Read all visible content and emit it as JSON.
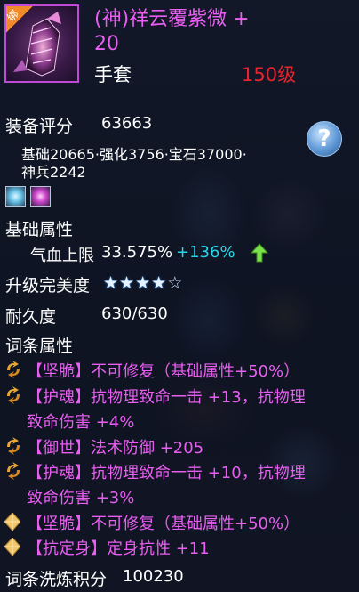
{
  "item": {
    "bound_tag": "绑",
    "title_line1": "(神)祥云覆紫微 +",
    "title_line2": "20",
    "type": "手套",
    "level": "150级"
  },
  "score": {
    "label": "装备评分",
    "value": "63663"
  },
  "breakdown": {
    "line1": "基础20665·强化3756·宝石37000·",
    "line2": "神兵2242"
  },
  "help": {
    "icon": "question-icon",
    "symbol": "?"
  },
  "gems": [
    "diamond-gem-icon",
    "ruby-gem-icon"
  ],
  "base_attr": {
    "header": "基础属性",
    "name": "气血上限",
    "value": "33.575%",
    "bonus": "+136%",
    "trend_icon": "arrow-up-icon"
  },
  "upgrade": {
    "label": "升级完美度",
    "stars_filled": 4,
    "stars_total": 5
  },
  "durability": {
    "label": "耐久度",
    "value": "630/630"
  },
  "affixes": {
    "header": "词条属性",
    "items": [
      {
        "icon": "refine-icon",
        "line1": "【坚脆】不可修复（基础属性+50%）",
        "line2": ""
      },
      {
        "icon": "refine-icon",
        "line1": "【护魂】抗物理致命一击 +13，抗物理",
        "line2": "致命伤害 +4%"
      },
      {
        "icon": "refine-icon",
        "line1": "【御世】法术防御 +205",
        "line2": ""
      },
      {
        "icon": "refine-icon",
        "line1": "【护魂】抗物理致命一击 +10，抗物理",
        "line2": "致命伤害 +3%"
      },
      {
        "icon": "diamond-icon",
        "line1": "【坚脆】不可修复（基础属性+50%）",
        "line2": ""
      },
      {
        "icon": "diamond-icon",
        "line1": "【抗定身】定身抗性 +11",
        "line2": ""
      }
    ]
  },
  "wash": {
    "label": "词条洗炼积分",
    "value": "100230"
  },
  "colors": {
    "title": "#e85ef0",
    "level": "#e8232f",
    "bonus": "#28d6ea",
    "affix": "#e85ef0",
    "icon_border": "#c04ad8"
  }
}
